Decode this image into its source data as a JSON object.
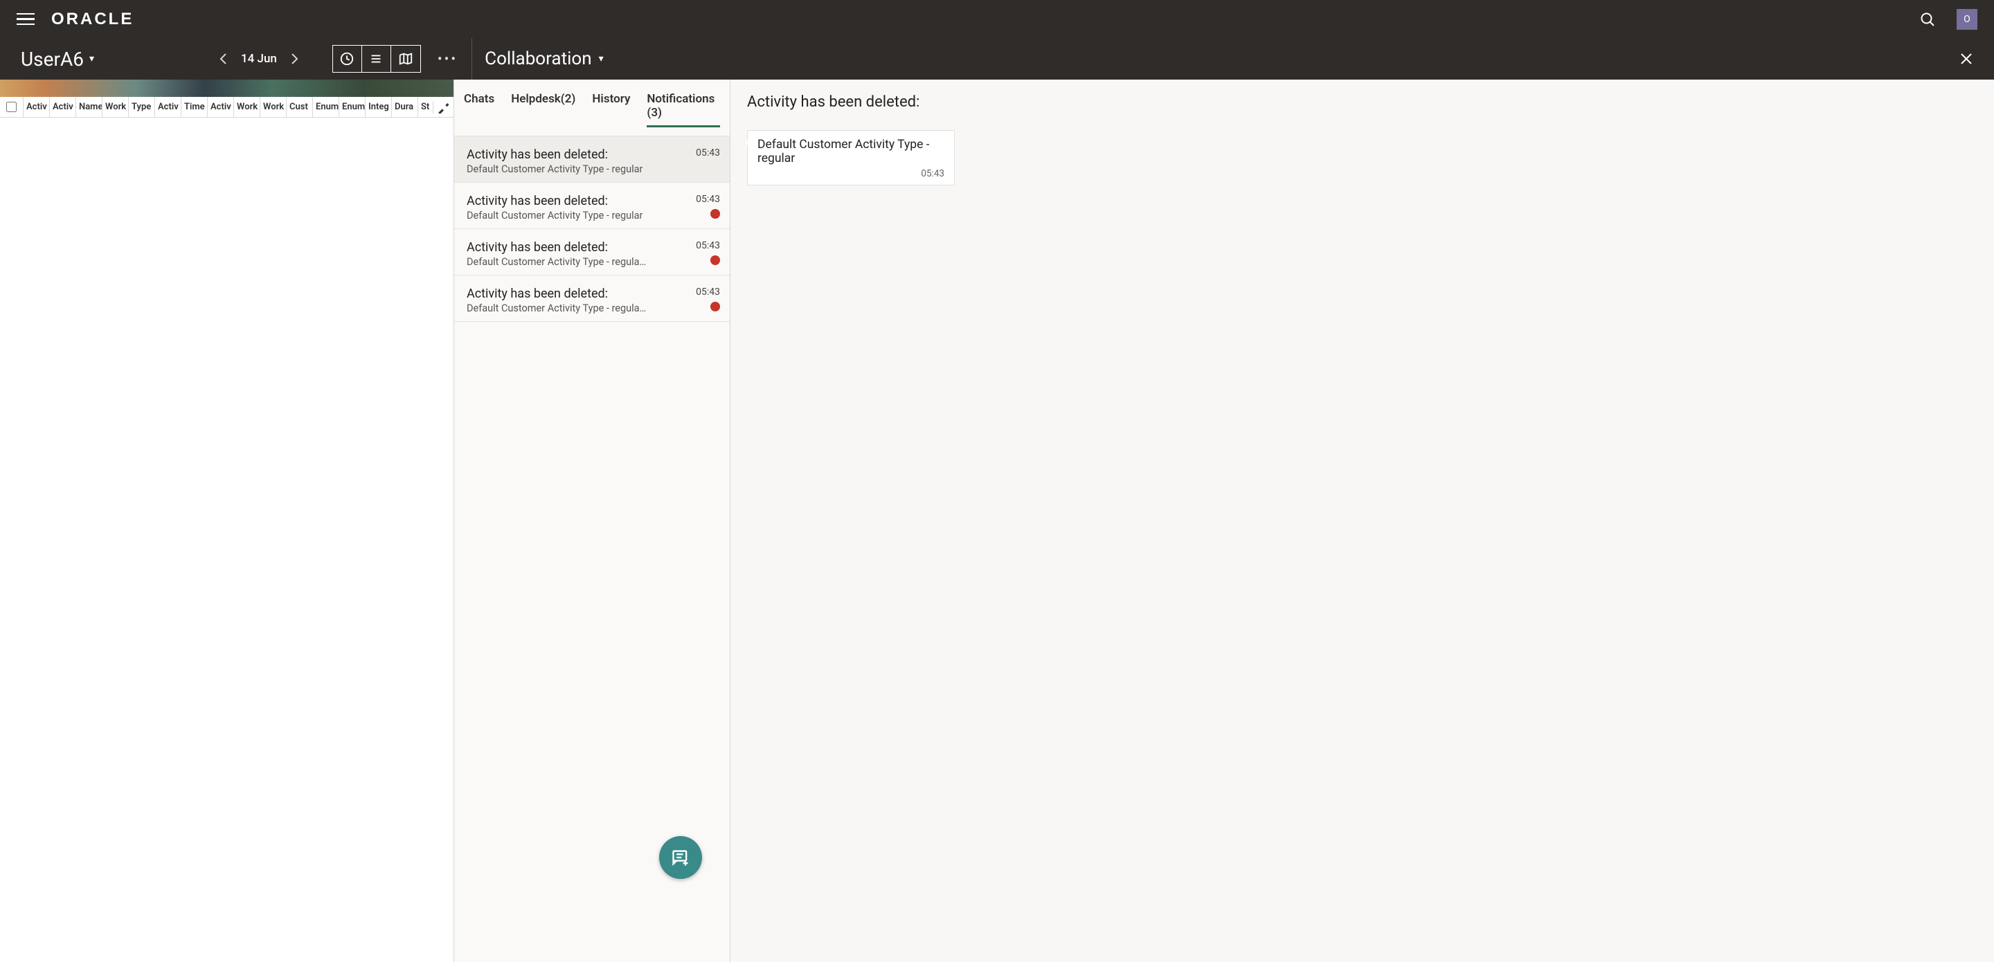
{
  "topbar": {
    "brand": "ORACLE",
    "avatar_letter": "O"
  },
  "secondbar": {
    "user": "UserA6",
    "date": "14 Jun",
    "panel_title": "Collaboration"
  },
  "columns": [
    "Activ",
    "Activ",
    "Name",
    "Work",
    "Type",
    "Activ",
    "Time",
    "Activ",
    "Work",
    "Work",
    "Cust",
    "Enum",
    "Enum",
    "Integ",
    "Dura",
    "St"
  ],
  "tabs": {
    "chats": "Chats",
    "helpdesk": "Helpdesk(2)",
    "history": "History",
    "notifications": "Notifications (3)"
  },
  "notifications": [
    {
      "title": "Activity has been deleted:",
      "sub": "Default Customer Activity Type - regular",
      "time": "05:43",
      "unread": false,
      "selected": true
    },
    {
      "title": "Activity has been deleted:",
      "sub": "Default Customer Activity Type - regular",
      "time": "05:43",
      "unread": true,
      "selected": false
    },
    {
      "title": "Activity has been deleted:",
      "sub": "Default Customer Activity Type - regular …",
      "time": "05:43",
      "unread": true,
      "selected": false
    },
    {
      "title": "Activity has been deleted:",
      "sub": "Default Customer Activity Type - regular …",
      "time": "05:43",
      "unread": true,
      "selected": false
    }
  ],
  "detail": {
    "title": "Activity has been deleted:",
    "message": "Default Customer Activity Type - regular",
    "time": "05:43"
  }
}
